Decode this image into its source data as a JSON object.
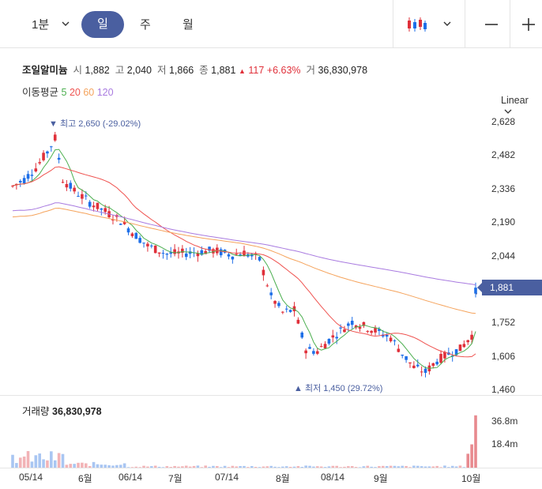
{
  "toolbar": {
    "interval_label": "1분",
    "tabs": [
      "일",
      "주",
      "월"
    ],
    "chevron": "chevron-down-icon",
    "chart_type_icon": "candlestick-icon",
    "minus_icon": "minus-icon",
    "plus_icon": "plus-icon"
  },
  "quote": {
    "name": "조일알미늄",
    "open_label": "시",
    "open": "1,882",
    "high_label": "고",
    "high": "2,040",
    "low_label": "저",
    "low": "1,866",
    "close_label": "종",
    "close": "1,881",
    "change_arrow": "▲",
    "change": "117",
    "change_pct": "+6.63%",
    "volume_label": "거",
    "volume": "36,830,978"
  },
  "moving_average": {
    "label": "이동평균",
    "periods": [
      {
        "value": "5",
        "color": "#4caf50"
      },
      {
        "value": "20",
        "color": "#ef5350"
      },
      {
        "value": "60",
        "color": "#f5a35c"
      },
      {
        "value": "120",
        "color": "#a97be0"
      }
    ]
  },
  "scale_label": "Linear",
  "colors": {
    "up": "#e0303a",
    "down": "#1e6fe8",
    "accent": "#4a5fa0"
  },
  "chart_data": {
    "type": "candlestick",
    "y_ticks": [
      "2,628",
      "2,482",
      "2,336",
      "2,190",
      "2,044",
      "1,752",
      "1,606",
      "1,460"
    ],
    "ylim": [
      1440,
      2680
    ],
    "x_ticks": [
      "05/14",
      "6월",
      "06/14",
      "7월",
      "07/14",
      "8월",
      "08/14",
      "9월",
      "10월"
    ],
    "current_price_tag": "1,881",
    "max_annotation": "▼ 최고 2,650 (-29.02%)",
    "min_annotation": "▲ 최저 1,450 (29.72%)",
    "volume_title": "거래량",
    "volume_value": "36,830,978",
    "volume_ticks": [
      "36.8m",
      "18.4m"
    ],
    "volume_max": 40
  }
}
